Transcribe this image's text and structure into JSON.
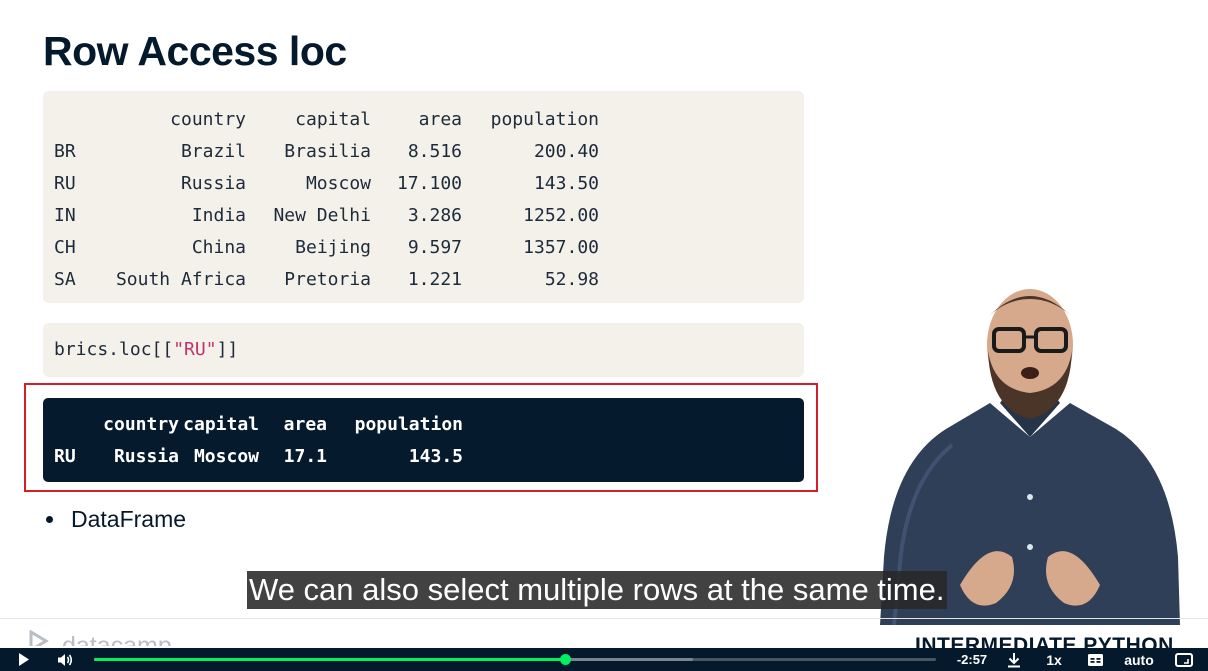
{
  "slide": {
    "title": "Row Access loc",
    "dataframe": {
      "columns": [
        "",
        "country",
        "capital",
        "area",
        "population"
      ],
      "rows": [
        [
          "BR",
          "Brazil",
          "Brasilia",
          "8.516",
          "200.40"
        ],
        [
          "RU",
          "Russia",
          "Moscow",
          "17.100",
          "143.50"
        ],
        [
          "IN",
          "India",
          "New Delhi",
          "3.286",
          "1252.00"
        ],
        [
          "CH",
          "China",
          "Beijing",
          "9.597",
          "1357.00"
        ],
        [
          "SA",
          "South Africa",
          "Pretoria",
          "1.221",
          "52.98"
        ]
      ]
    },
    "command": {
      "prefix": "brics.loc[[",
      "string": "\"RU\"",
      "suffix": "]]"
    },
    "output": {
      "columns": [
        "",
        "country",
        "capital",
        "area",
        "population"
      ],
      "rows": [
        [
          "RU",
          "Russia",
          "Moscow",
          "17.1",
          "143.5"
        ]
      ]
    },
    "bullets": [
      "DataFrame"
    ],
    "footer": {
      "brand": "datacamp",
      "course": "INTERMEDIATE PYTHON"
    }
  },
  "subtitle": "We can also select multiple rows at the same time.",
  "player": {
    "time_remaining": "-2:57",
    "speed": "1x",
    "quality": "auto",
    "progress": 0.559,
    "buffered": 0.711,
    "icons": {
      "play": "play-icon",
      "volume": "volume-icon",
      "download": "download-icon",
      "captions": "captions-icon",
      "fullscreen": "fullscreen-icon"
    },
    "accent_color": "#03ef62"
  },
  "colors": {
    "title": "#05192d",
    "code_bg": "#f4f1ea",
    "output_bg": "#061a2e",
    "highlight_border": "#d31f2a",
    "string_literal": "#c2336a"
  }
}
